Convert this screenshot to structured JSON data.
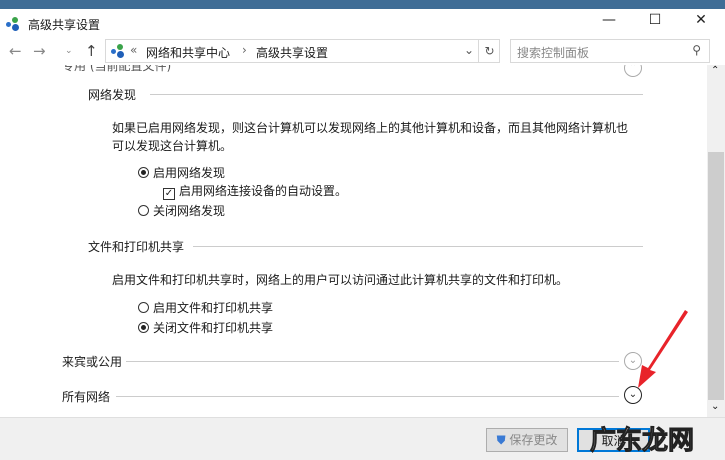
{
  "window": {
    "title": "高级共享设置"
  },
  "address": {
    "prefix": "«",
    "crumbs": [
      "网络和共享中心",
      "高级共享设置"
    ],
    "sep": "›"
  },
  "search": {
    "placeholder": "搜索控制面板"
  },
  "sections": {
    "private_header": "专用 (当前配置文件)",
    "discovery": {
      "title": "网络发现",
      "desc1": "如果已启用网络发现，则这台计算机可以发现网络上的其他计算机和设备，而且其他网络计算机也",
      "desc2": "可以发现这台计算机。",
      "on": "启用网络发现",
      "auto": "启用网络连接设备的自动设置。",
      "off": "关闭网络发现"
    },
    "sharing": {
      "title": "文件和打印机共享",
      "desc": "启用文件和打印机共享时，网络上的用户可以访问通过此计算机共享的文件和打印机。",
      "on": "启用文件和打印机共享",
      "off": "关闭文件和打印机共享"
    },
    "guest": "来宾或公用",
    "all": "所有网络"
  },
  "footer": {
    "save": "保存更改",
    "cancel": "取消"
  },
  "watermark": "广东龙网"
}
